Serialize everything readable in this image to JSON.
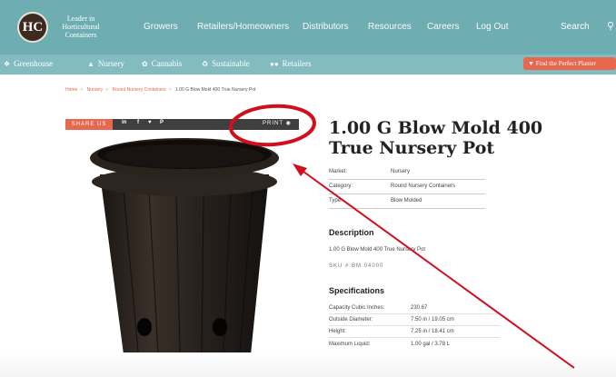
{
  "header": {
    "logo_text": "HC",
    "tagline": "Leader in Horticultural Containers",
    "nav": [
      "Growers",
      "Retailers/Homeowners",
      "Distributors",
      "Resources",
      "Careers",
      "Log Out"
    ],
    "search_label": "Search",
    "search_icon": "magnifier"
  },
  "subnav": {
    "items": [
      {
        "label": "Greenhouse",
        "icon": "sprout"
      },
      {
        "label": "Nursery",
        "icon": "tree"
      },
      {
        "label": "Cannabis",
        "icon": "leaf"
      },
      {
        "label": "Sustainable",
        "icon": "recycle"
      },
      {
        "label": "Retailers",
        "icon": "people"
      }
    ],
    "cta_label": "Find the Perfect Planter"
  },
  "breadcrumb": {
    "items": [
      "Home",
      "Nursery",
      "Round Nursery Containers"
    ],
    "current": "1.00 G Blow Mold 400 True Nursery Pot"
  },
  "share": {
    "label": "SHARE US",
    "icons": [
      "in",
      "f",
      "♥",
      "P"
    ],
    "print_label": "PRINT"
  },
  "product": {
    "title": "1.00 G Blow Mold 400 True Nursery Pot",
    "meta": [
      {
        "label": "Market:",
        "value": "Nursery"
      },
      {
        "label": "Category:",
        "value": "Round Nursery Containers"
      },
      {
        "label": "Type:",
        "value": "Blow Molded"
      }
    ],
    "description_heading": "Description",
    "description": "1.00 G Blow Mold 400 True Nursery Pot",
    "sku": "SKU #:BM.04000",
    "specs_heading": "Specifications",
    "specs": [
      {
        "label": "Capacity Cubic Inches:",
        "value": "230.67"
      },
      {
        "label": "Outside Diameter:",
        "value": "7.50 in / 19.05 cm"
      },
      {
        "label": "Height:",
        "value": "7.25 in / 18.41 cm"
      },
      {
        "label": "Maximum Liquid:",
        "value": "1.00 gal / 3.78 L"
      }
    ]
  },
  "colors": {
    "header_teal": "#6eaeb3",
    "accent_coral": "#e8674f",
    "annotation_red": "#d10f1c"
  }
}
